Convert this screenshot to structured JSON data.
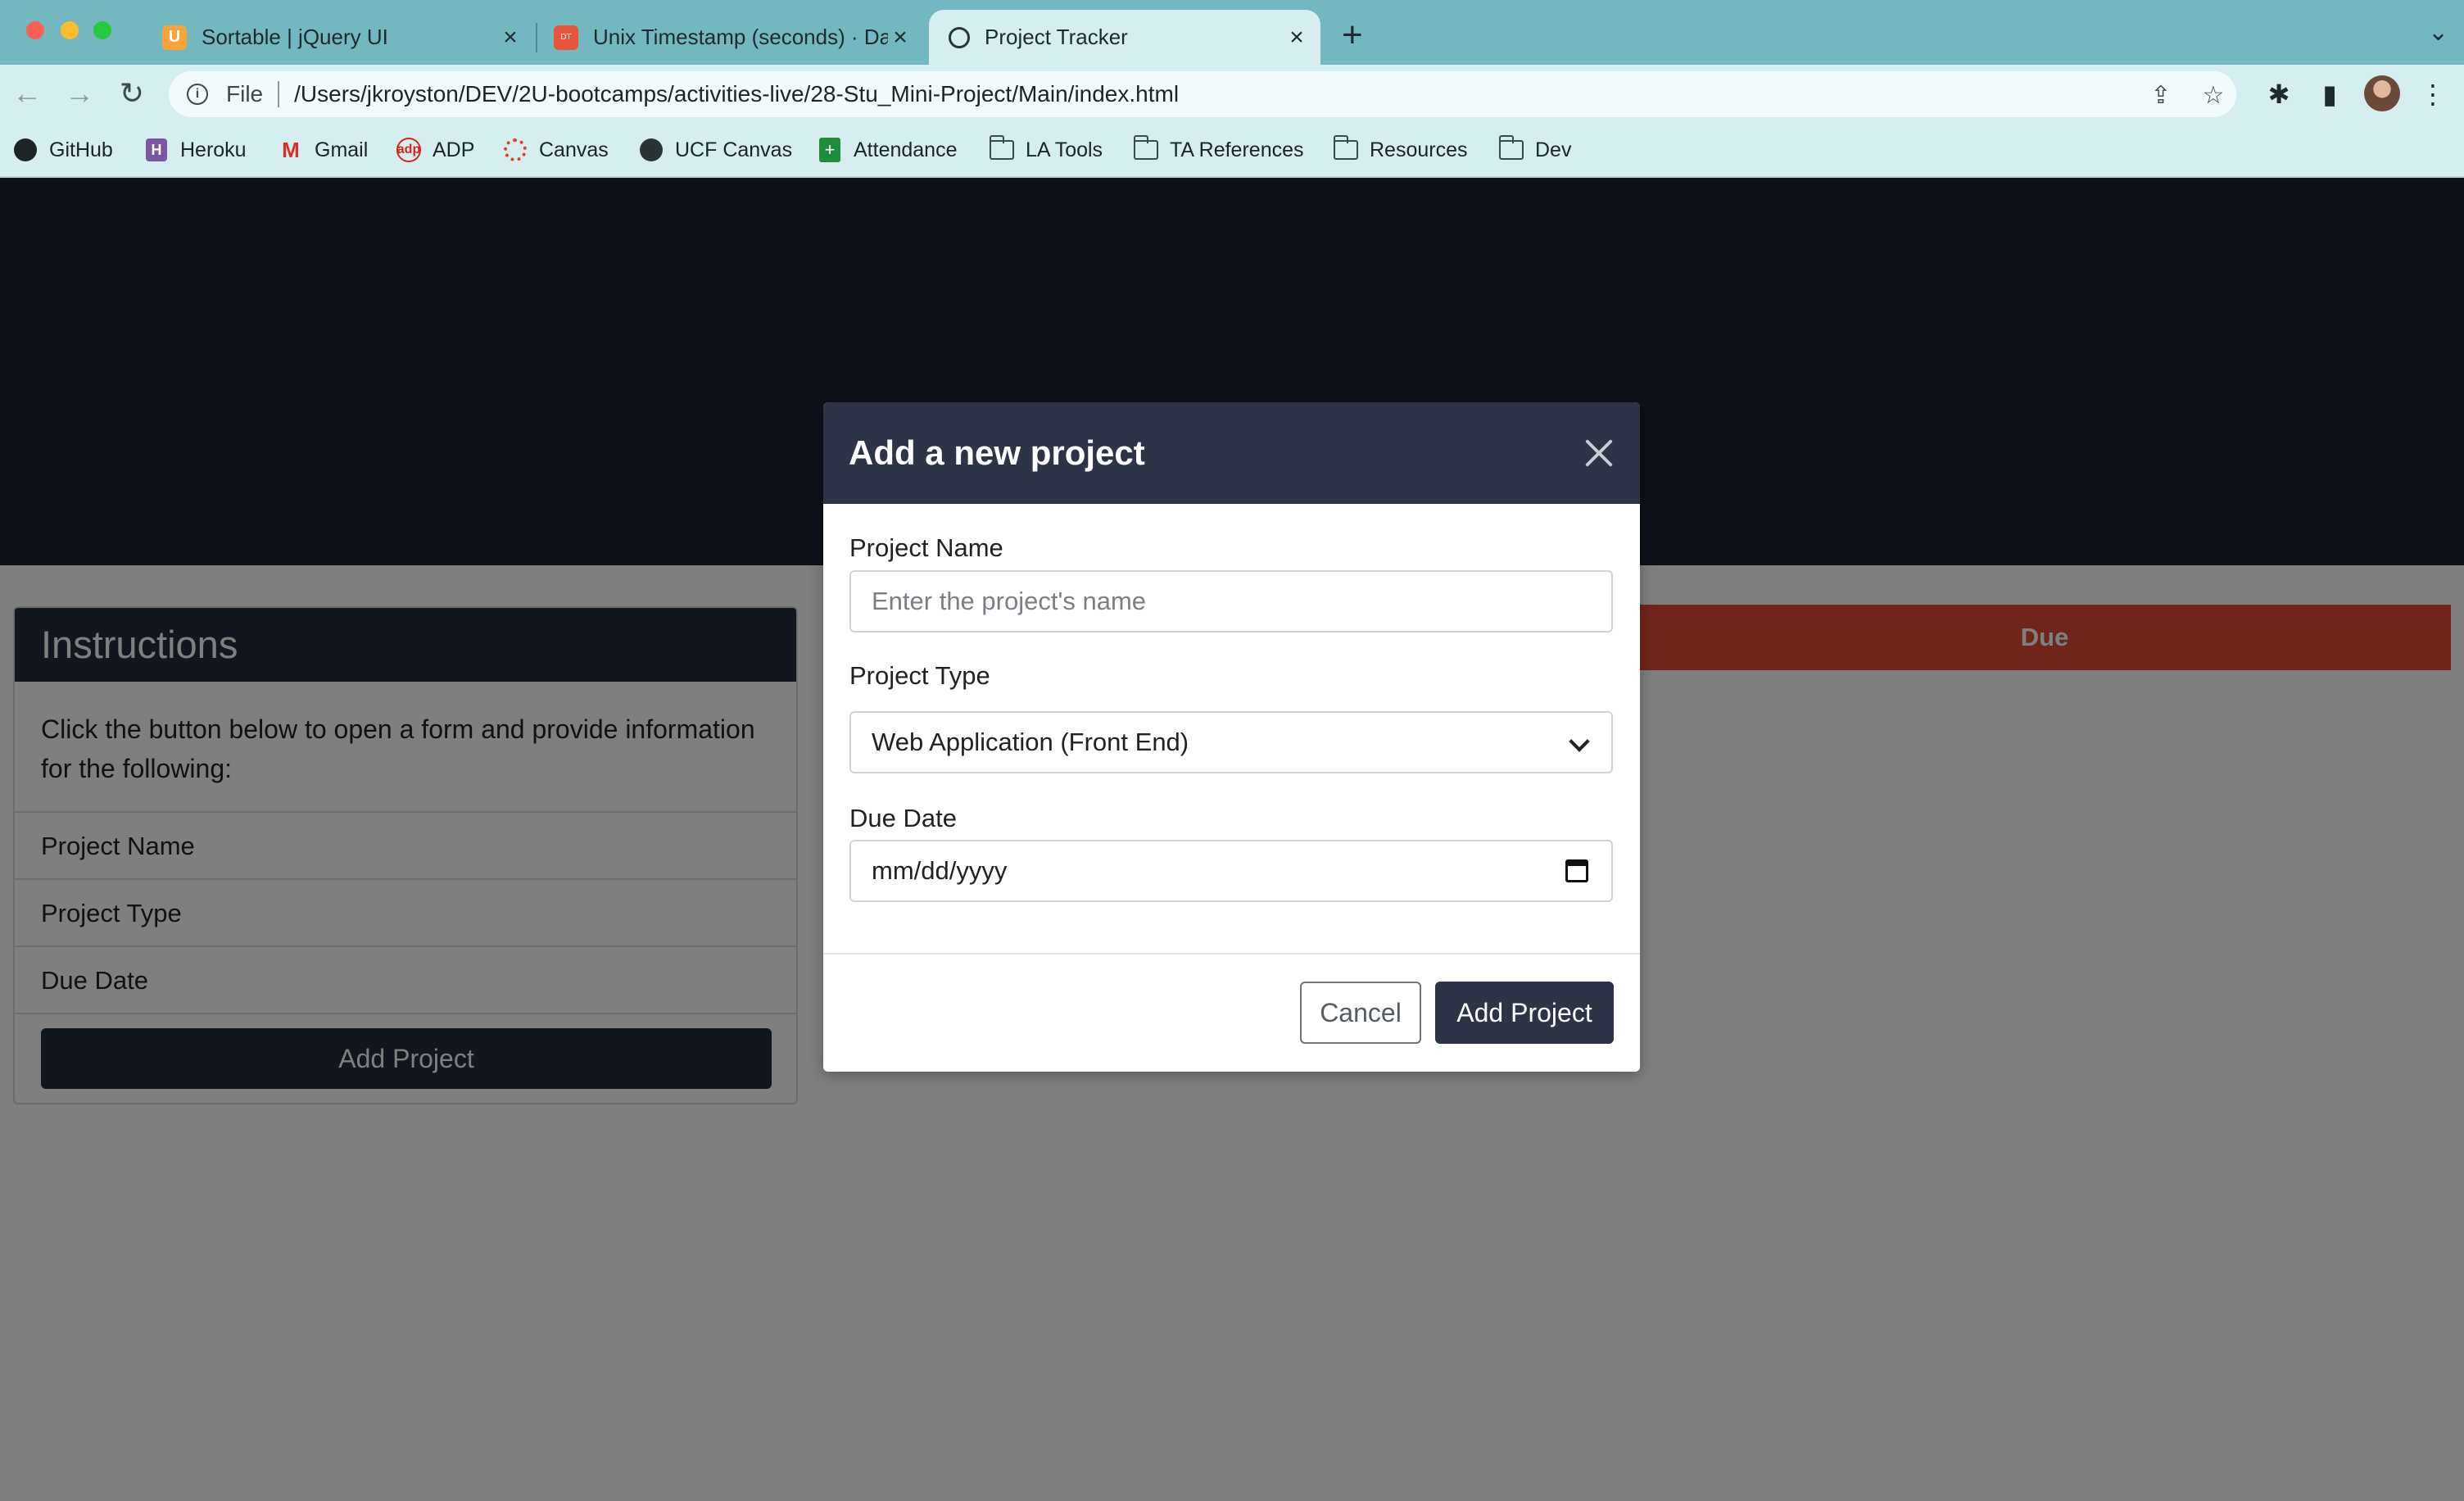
{
  "browser": {
    "tabs": [
      {
        "title": "Sortable | jQuery UI",
        "active": false
      },
      {
        "title": "Unix Timestamp (seconds) · Da",
        "active": false
      },
      {
        "title": "Project Tracker",
        "active": true
      }
    ],
    "address": {
      "scheme": "File",
      "url": "/Users/jkroyston/DEV/2U-bootcamps/activities-live/28-Stu_Mini-Project/Main/index.html"
    },
    "bookmarks": [
      {
        "label": "GitHub",
        "icon": "github-icon"
      },
      {
        "label": "Heroku",
        "icon": "heroku-icon"
      },
      {
        "label": "Gmail",
        "icon": "gmail-icon"
      },
      {
        "label": "ADP",
        "icon": "adp-icon"
      },
      {
        "label": "Canvas",
        "icon": "canvas-icon"
      },
      {
        "label": "UCF Canvas",
        "icon": "ucf-icon"
      },
      {
        "label": "Attendance",
        "icon": "sheets-icon"
      },
      {
        "label": "LA Tools",
        "icon": "folder-icon"
      },
      {
        "label": "TA References",
        "icon": "folder-icon"
      },
      {
        "label": "Resources",
        "icon": "folder-icon"
      },
      {
        "label": "Dev",
        "icon": "folder-icon"
      }
    ]
  },
  "instructions": {
    "title": "Instructions",
    "text": "Click the button below to open a form and provide information for the following:",
    "items": [
      "Project Name",
      "Project Type",
      "Due Date"
    ],
    "button": "Add Project"
  },
  "table": {
    "due_header": "Due"
  },
  "modal": {
    "title": "Add a new project",
    "name_label": "Project Name",
    "name_placeholder": "Enter the project's name",
    "type_label": "Project Type",
    "type_value": "Web Application (Front End)",
    "date_label": "Due Date",
    "date_placeholder": "mm/dd/yyyy",
    "cancel": "Cancel",
    "submit": "Add Project"
  },
  "colors": {
    "navy": "#2d3446",
    "due_red": "#e04a32",
    "tabstrip": "#73b8bf"
  }
}
